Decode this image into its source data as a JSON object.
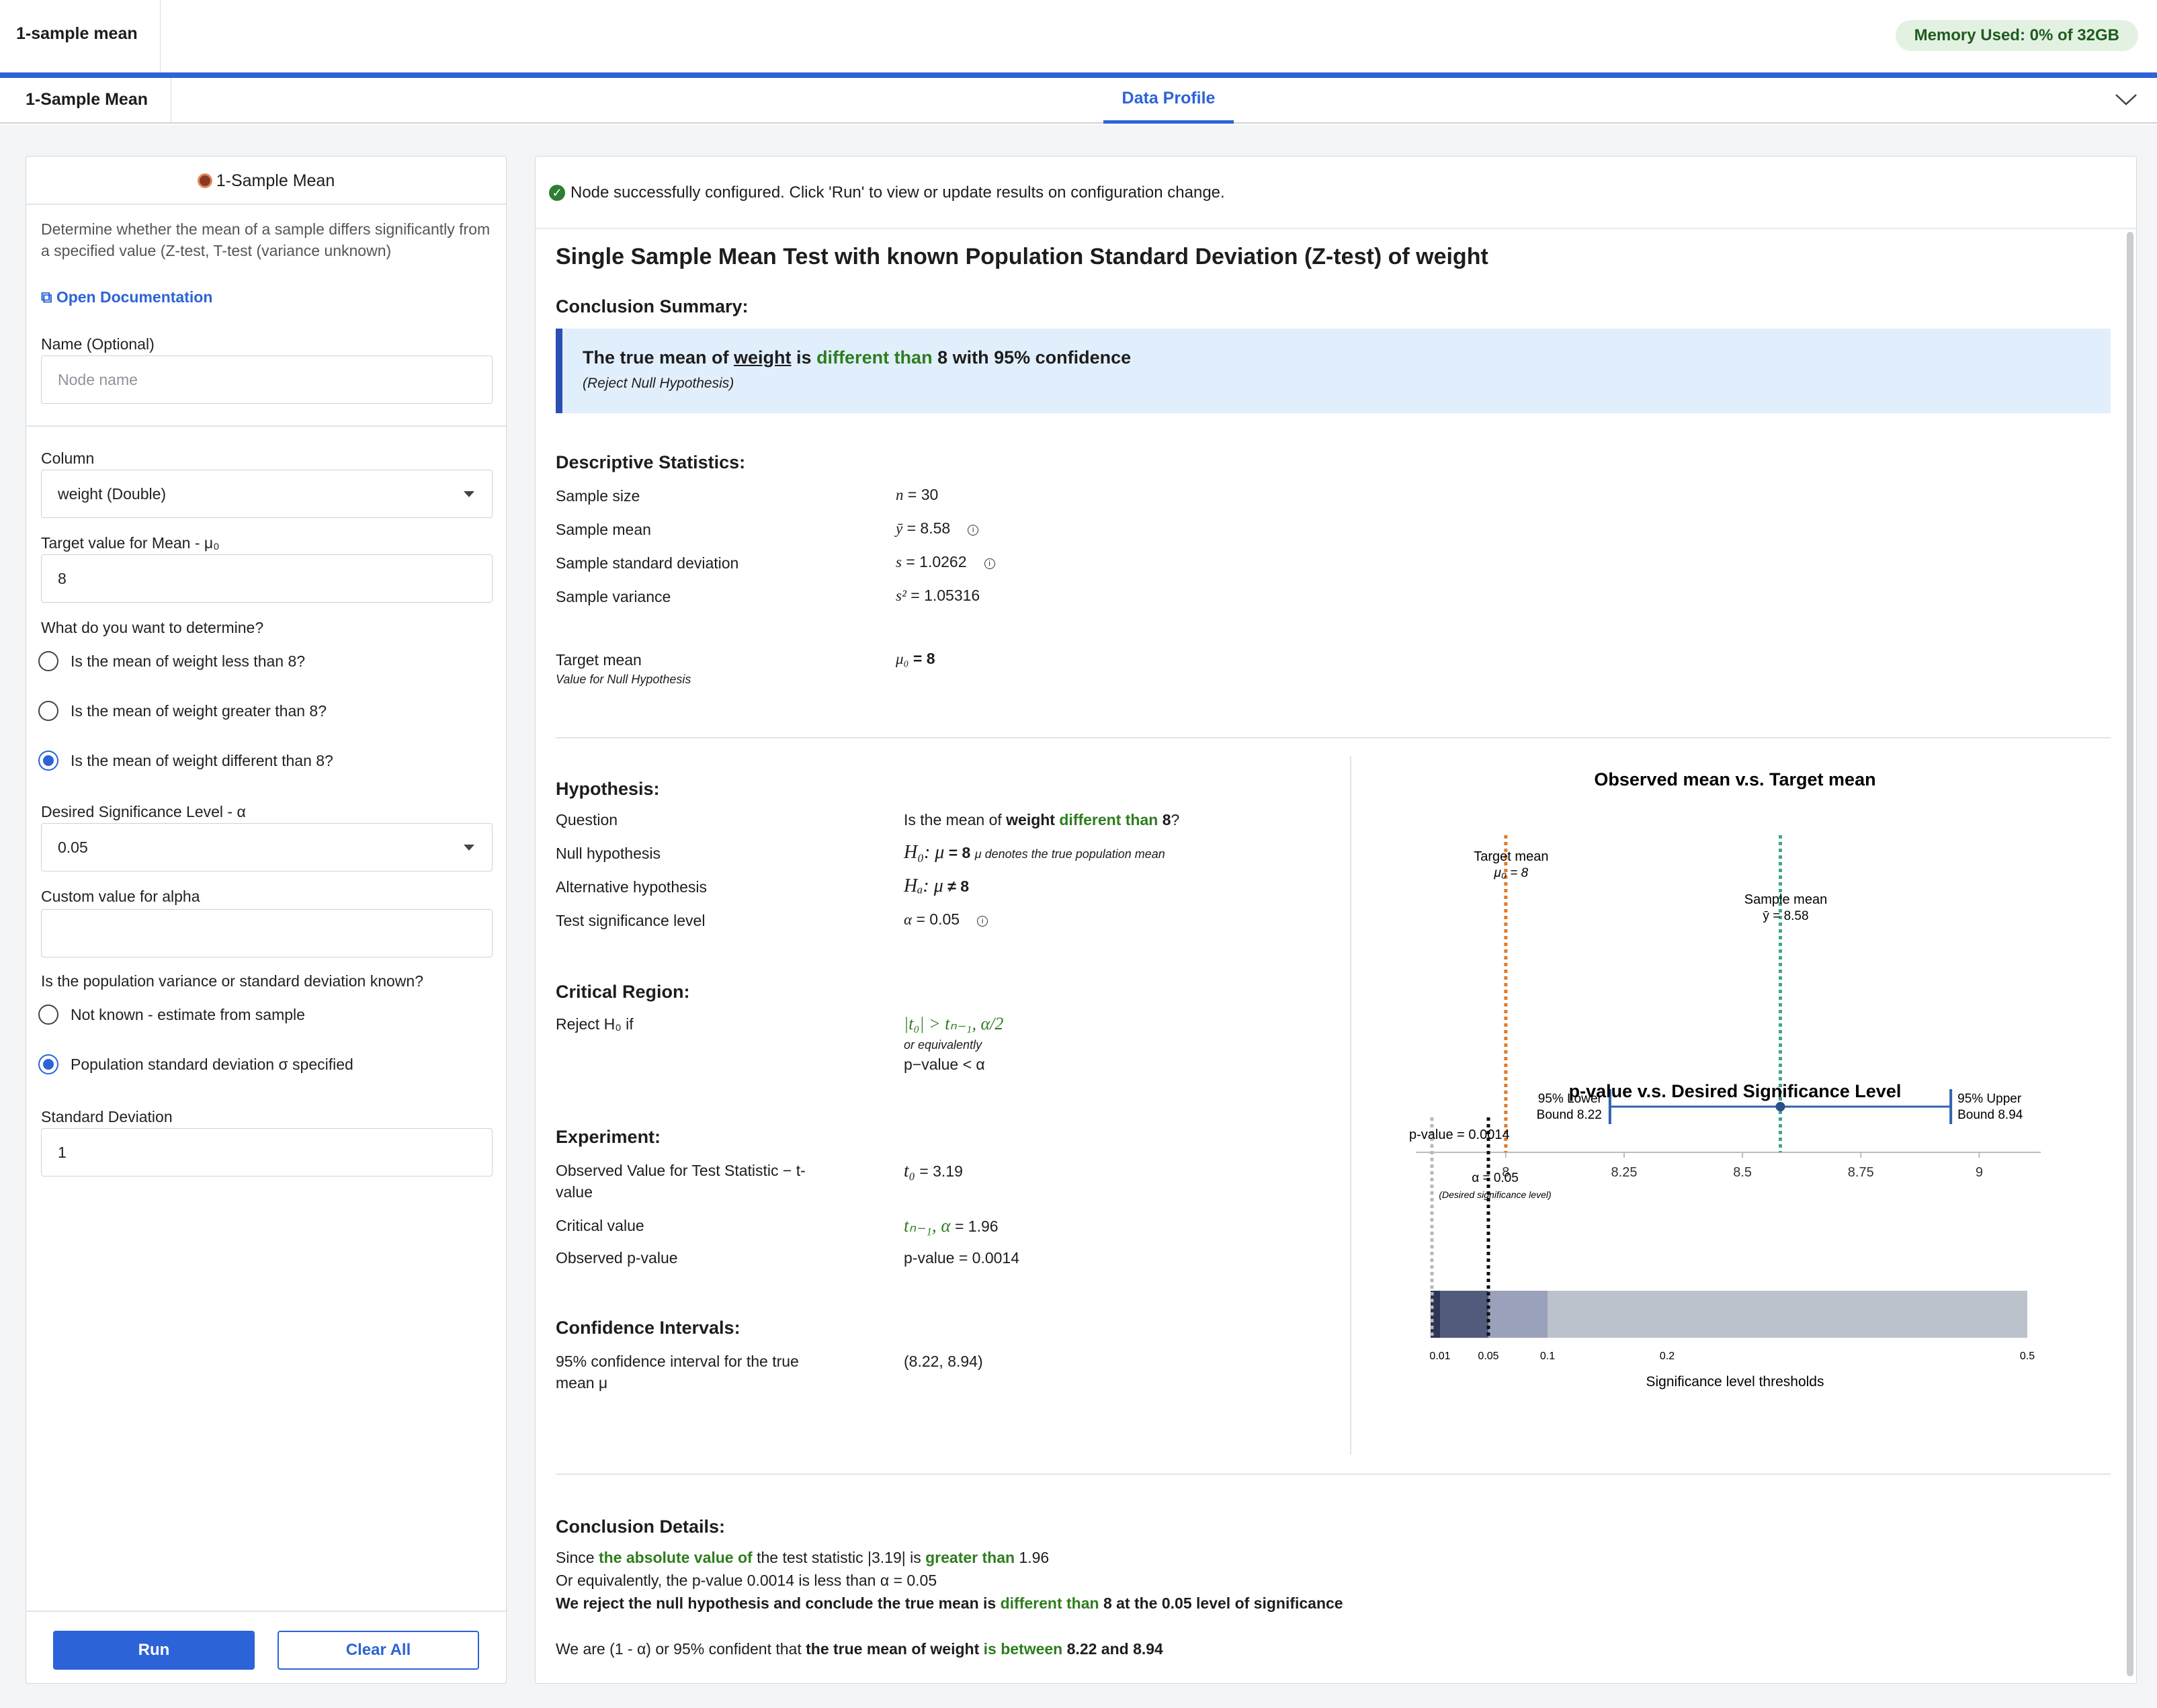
{
  "app": {
    "title": "1-sample mean",
    "memory": "Memory Used: 0% of 32GB"
  },
  "tabs": {
    "node_tab": "1-Sample Mean",
    "data_profile": "Data Profile"
  },
  "panel": {
    "title": "1-Sample Mean",
    "description": "Determine whether the mean of a sample differs significantly from a specified value (Z-test, T-test (variance unknown)",
    "doc_link": "Open Documentation",
    "name_label": "Name (Optional)",
    "name_placeholder": "Node name",
    "column_label": "Column",
    "column_value": "weight (Double)",
    "target_label": "Target value for Mean - μ₀",
    "target_value": "8",
    "determine_label": "What do you want to determine?",
    "options": [
      "Is the mean of weight less than 8?",
      "Is the mean of weight greater than 8?",
      "Is the mean of weight different than 8?"
    ],
    "selected_option": 2,
    "alpha_label": "Desired Significance Level - α",
    "alpha_value": "0.05",
    "custom_alpha_label": "Custom value for alpha",
    "custom_alpha_value": "",
    "variance_label": "Is the population variance or standard deviation known?",
    "variance_options": [
      "Not known - estimate from sample",
      "Population standard deviation σ specified"
    ],
    "variance_selected": 1,
    "sd_label": "Standard Deviation",
    "sd_value": "1",
    "run": "Run",
    "clear": "Clear All"
  },
  "results": {
    "status": "Node successfully configured. Click 'Run' to view or update results on configuration change.",
    "heading": "Single Sample Mean Test with known Population Standard Deviation (Z-test) of weight",
    "conclusion_summary_title": "Conclusion Summary:",
    "conclusion": {
      "p1": "The true mean of ",
      "var": "weight",
      "p2": " is ",
      "rel": "different than",
      "p3": " 8 with 95% confidence",
      "sub": "(Reject Null Hypothesis)"
    },
    "descriptive_title": "Descriptive Statistics:",
    "descriptive": [
      {
        "label": "Sample size",
        "sym": "n",
        "val": " = 30"
      },
      {
        "label": "Sample mean",
        "sym": "ȳ",
        "val": " = 8.58"
      },
      {
        "label": "Sample standard deviation",
        "sym": "s",
        "val": " = 1.0262"
      },
      {
        "label": "Sample variance",
        "sym": "s²",
        "val": " = 1.05316"
      }
    ],
    "target": {
      "label": "Target mean",
      "sub": "Value for Null Hypothesis",
      "sym": "μ₀",
      "val": " = 8"
    },
    "hypothesis_title": "Hypothesis:",
    "hypothesis": {
      "q_label": "Question",
      "q1": "Is the mean of ",
      "q_var": "weight",
      "q_rel": " different than ",
      "q_val": "8",
      "q_end": "?",
      "null_label": "Null hypothesis",
      "null_sym": "H₀: μ",
      "null_val": " = 8",
      "null_note": "μ denotes the true population mean",
      "alt_label": "Alternative hypothesis",
      "alt_sym": "Hₐ: μ",
      "alt_val": " ≠ 8",
      "sig_label": "Test significance level",
      "sig_sym": "α",
      "sig_val": " = 0.05"
    },
    "critical_title": "Critical Region:",
    "critical": {
      "label": "Reject H₀ if",
      "expr": "|t₀| > tₙ₋₁, α/2",
      "or": "or equivalently",
      "pexpr": "p−value < α"
    },
    "experiment_title": "Experiment:",
    "experiment": [
      {
        "label": "Observed Value for Test Statistic − t-",
        "label2": "value",
        "sym": "t₀",
        "val": " = 3.19"
      },
      {
        "label": "Critical value",
        "sym": "tₙ₋₁, α",
        "val": " = 1.96"
      },
      {
        "label": "Observed p-value",
        "sym": "",
        "val": "p-value = 0.0014"
      }
    ],
    "ci_title": "Confidence Intervals:",
    "ci": {
      "label": "95% confidence interval for the true",
      "label2": "mean μ",
      "val": "(8.22, 8.94)"
    },
    "details_title": "Conclusion Details:",
    "details": {
      "l1a": "Since ",
      "l1b": "the absolute value of",
      "l1c": " the test statistic |3.19| is ",
      "l1d": "greater than",
      "l1e": " 1.96",
      "l2": "Or equivalently, the p-value 0.0014 is less than α = 0.05",
      "l3a": "We reject the null hypothesis and conclude the true mean is ",
      "l3b": "different than",
      "l3c": " 8 at the 0.05 level of significance",
      "l4a": "We are (1 - α) or 95% confident that ",
      "l4b": "the true mean of weight ",
      "l4c": "is between",
      "l4d": " 8.22 and 8.94"
    }
  },
  "chart_data": [
    {
      "type": "scatter",
      "title": "Observed mean v.s. Target mean",
      "xticks": [
        8,
        8.25,
        8.5,
        8.75,
        9
      ],
      "xlim": [
        7.81,
        9.13
      ],
      "target_mean": 8,
      "target_label": "Target mean",
      "target_sub": "μ₀ = 8",
      "sample_mean": 8.58,
      "sample_label": "Sample mean",
      "sample_sub": "ȳ = 8.58",
      "lower": 8.22,
      "lower_label1": "95% Lower",
      "lower_label2": "Bound 8.22",
      "upper": 8.94,
      "upper_label1": "95% Upper",
      "upper_label2": "Bound 8.94",
      "colors": {
        "target": "#e07b2a",
        "sample": "#3aa88a",
        "interval": "#2f63b0"
      }
    },
    {
      "type": "bar",
      "title": "p-value v.s. Desired Significance Level",
      "xlabel": "Significance level thresholds",
      "xticks": [
        0.01,
        0.05,
        0.1,
        0.2,
        0.5
      ],
      "bands": [
        {
          "from": 0,
          "to": 0.01,
          "color": "#2f3655"
        },
        {
          "from": 0.01,
          "to": 0.05,
          "color": "#535b7c"
        },
        {
          "from": 0.05,
          "to": 0.1,
          "color": "#9aa1bb"
        },
        {
          "from": 0.1,
          "to": 0.5,
          "color": "#bcc2cb"
        }
      ],
      "pvalue": 0.0014,
      "p_label": "p-value = 0.0014",
      "alpha": 0.05,
      "alpha_label": "α = 0.05",
      "alpha_sub": "(Desired significance level)"
    }
  ]
}
